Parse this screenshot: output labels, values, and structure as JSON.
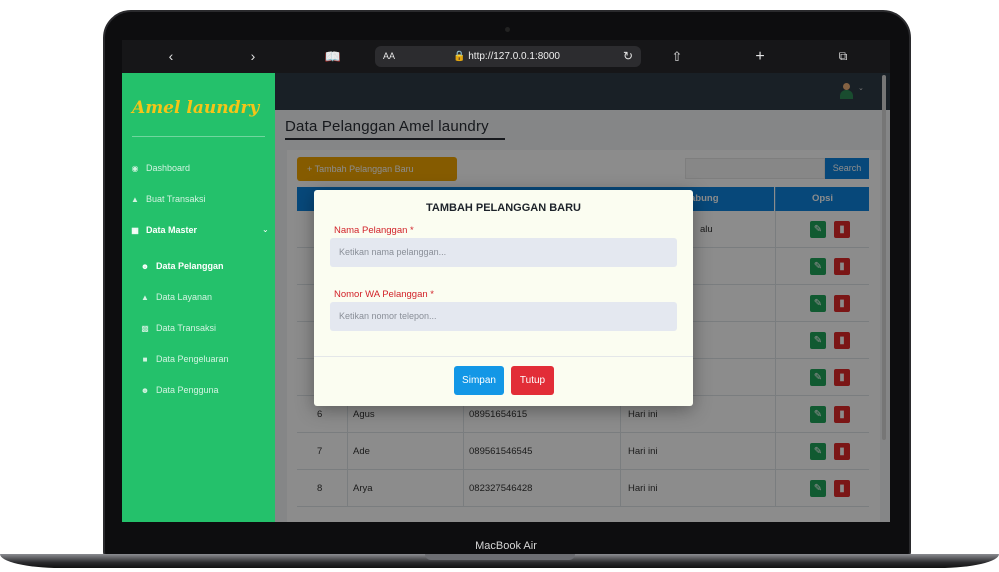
{
  "device": {
    "caption": "MacBook Air"
  },
  "browser": {
    "back_icon": "chevron-left-icon",
    "forward_icon": "chevron-right-icon",
    "text_size_label": "AA",
    "url": "http://127.0.0.1:8000"
  },
  "sidebar": {
    "logo": "Amel laundry",
    "items": [
      {
        "label": "Dashboard",
        "icon": "dashboard-icon",
        "active": false
      },
      {
        "label": "Buat Transaksi",
        "icon": "basket-icon",
        "active": false
      },
      {
        "label": "Data Master",
        "icon": "table-icon",
        "active": true
      }
    ],
    "sub_items": [
      {
        "label": "Data Pelanggan",
        "icon": "users-icon",
        "active": true
      },
      {
        "label": "Data Layanan",
        "icon": "shirt-icon",
        "active": false
      },
      {
        "label": "Data Transaksi",
        "icon": "chart-icon",
        "active": false
      },
      {
        "label": "Data Pengeluaran",
        "icon": "money-icon",
        "active": false
      },
      {
        "label": "Data Pengguna",
        "icon": "user-group-icon",
        "active": false
      }
    ]
  },
  "main": {
    "title": "Data Pelanggan Amel laundry",
    "add_button": "+ Tambah Pelanggan Baru",
    "search_button": "Search",
    "columns": {
      "joined_partial": "abung",
      "options": "Opsi"
    },
    "first_row_joined_partial": "alu",
    "rows": [
      {
        "no": "6",
        "name": "Agus",
        "phone": "08951654615",
        "joined": "Hari ini"
      },
      {
        "no": "7",
        "name": "Ade",
        "phone": "089561546545",
        "joined": "Hari ini"
      },
      {
        "no": "8",
        "name": "Arya",
        "phone": "082327546428",
        "joined": "Hari ini"
      }
    ]
  },
  "modal": {
    "title": "TAMBAH PELANGGAN BARU",
    "name_label": "Nama Pelanggan *",
    "name_placeholder": "Ketikan nama pelanggan...",
    "phone_label": "Nomor WA Pelanggan *",
    "phone_placeholder": "Ketikan nomor telepon...",
    "save_button": "Simpan",
    "close_button": "Tutup"
  }
}
